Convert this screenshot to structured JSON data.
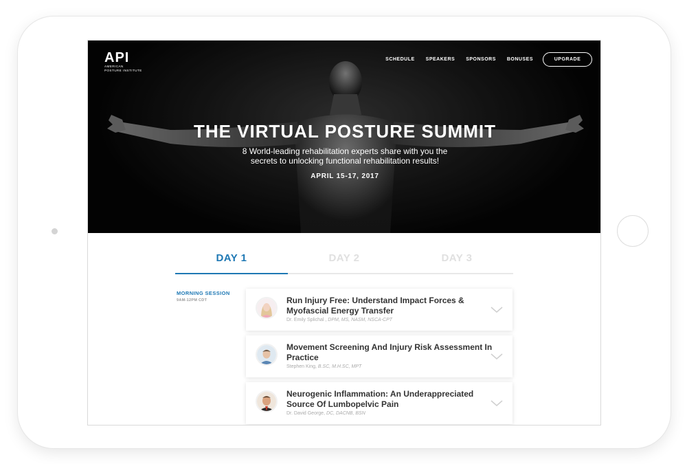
{
  "nav": {
    "logo_mark": "API",
    "logo_line1": "AMERICAN",
    "logo_line2": "POSTURE INSTITUTE",
    "links": [
      "SCHEDULE",
      "SPEAKERS",
      "SPONSORS",
      "BONUSES"
    ],
    "upgrade_label": "UPGRADE"
  },
  "hero": {
    "title": "THE VIRTUAL POSTURE SUMMIT",
    "subtitle": "8 World-leading rehabilitation experts share with you the secrets to unlocking functional rehabilitation results!",
    "date": "APRIL 15-17, 2017"
  },
  "tabs": [
    {
      "label": "DAY 1",
      "active": true
    },
    {
      "label": "DAY 2",
      "active": false
    },
    {
      "label": "DAY 3",
      "active": false
    }
  ],
  "session": {
    "name": "MORNING SESSION",
    "time": "9AM-12PM CDT"
  },
  "talks": [
    {
      "title": "Run Injury Free:  Understand Impact Forces & Myofascial Energy Transfer",
      "speaker_name": "Dr. Emily Splichal ,",
      "speaker_creds": " DPM, MS, NASM, NSCA-CPT"
    },
    {
      "title": "Movement Screening And Injury Risk Assessment In Practice",
      "speaker_name": "Stephen King,",
      "speaker_creds": " B.SC, M.H.SC, MPT"
    },
    {
      "title": "Neurogenic Inflammation: An Underappreciated Source Of Lumbopelvic Pain",
      "speaker_name": "Dr. David George,",
      "speaker_creds": " DC, DACNB, BSN"
    }
  ],
  "colors": {
    "accent": "#1e78b4",
    "inactive_tab": "#e0e0e0",
    "hero_bg": "#0a0a0a"
  },
  "icons": {
    "chevron": "chevron-down-icon"
  }
}
